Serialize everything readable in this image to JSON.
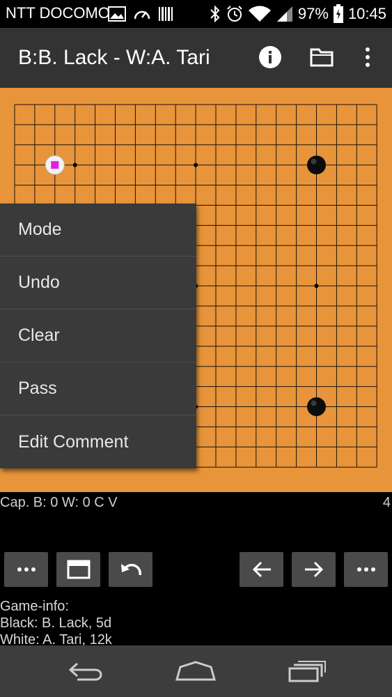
{
  "status_bar": {
    "carrier": "NTT DOCOMO",
    "battery": "97%",
    "time": "10:45",
    "icons": [
      "image-icon",
      "speedometer-icon",
      "barcode-icon",
      "bluetooth-icon",
      "alarm-icon",
      "wifi-icon",
      "signal-icon",
      "battery-icon"
    ]
  },
  "app_bar": {
    "title": "B:B. Lack - W:A. Tari",
    "actions": [
      "info-icon",
      "folder-icon",
      "overflow-menu-icon"
    ]
  },
  "board": {
    "size": 19,
    "background": "#e8943a",
    "stones": [
      {
        "color": "white",
        "col": 2,
        "row": 3,
        "marker": "square",
        "marker_color": "#e020e0"
      },
      {
        "color": "black",
        "col": 15,
        "row": 3
      },
      {
        "color": "black",
        "col": 15,
        "row": 15
      }
    ],
    "hoshi": [
      [
        3,
        3
      ],
      [
        9,
        3
      ],
      [
        15,
        3
      ],
      [
        3,
        9
      ],
      [
        9,
        9
      ],
      [
        15,
        9
      ],
      [
        3,
        15
      ],
      [
        9,
        15
      ],
      [
        15,
        15
      ]
    ]
  },
  "popup_menu": {
    "items": [
      "Mode",
      "Undo",
      "Clear",
      "Pass",
      "Edit Comment"
    ]
  },
  "status_line": {
    "captures": "Cap. B: 0  W: 0  C  V",
    "move_number": "4"
  },
  "toolbar": {
    "left_buttons": [
      "more-icon",
      "window-icon",
      "undo-icon"
    ],
    "right_buttons": [
      "arrow-left-icon",
      "arrow-right-icon",
      "more-icon"
    ]
  },
  "game_info": {
    "header": "Game-info:",
    "black": "Black: B. Lack, 5d",
    "white": "White: A. Tari, 12k"
  },
  "nav_bar": {
    "buttons": [
      "back-icon",
      "home-icon",
      "recents-icon"
    ]
  }
}
